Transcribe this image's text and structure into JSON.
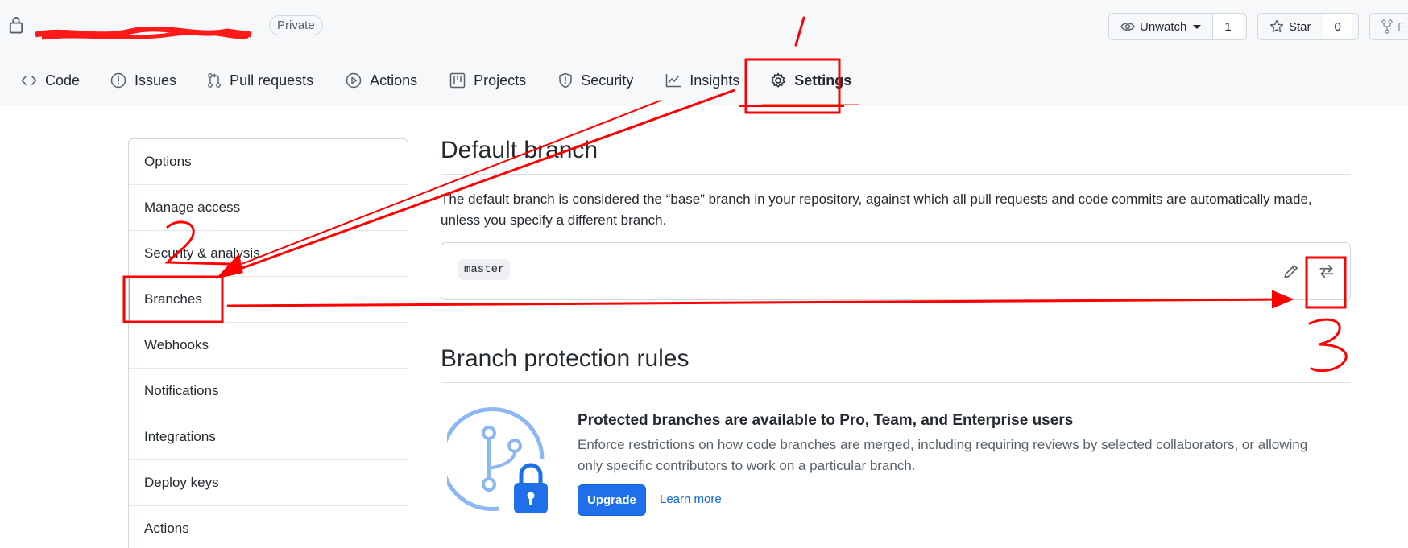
{
  "repo": {
    "visibility": "Private",
    "watch": {
      "label": "Unwatch",
      "count": "1"
    },
    "star": {
      "label": "Star",
      "count": "0"
    },
    "fork": {
      "label": "F"
    }
  },
  "nav": {
    "tabs": [
      {
        "label": "Code",
        "icon": "code-icon"
      },
      {
        "label": "Issues",
        "icon": "issue-icon"
      },
      {
        "label": "Pull requests",
        "icon": "pull-request-icon"
      },
      {
        "label": "Actions",
        "icon": "play-icon"
      },
      {
        "label": "Projects",
        "icon": "project-icon"
      },
      {
        "label": "Security",
        "icon": "shield-icon"
      },
      {
        "label": "Insights",
        "icon": "graph-icon"
      },
      {
        "label": "Settings",
        "icon": "gear-icon",
        "selected": true
      }
    ]
  },
  "sidebar": {
    "items": [
      {
        "label": "Options"
      },
      {
        "label": "Manage access"
      },
      {
        "label": "Security & analysis"
      },
      {
        "label": "Branches",
        "active": true
      },
      {
        "label": "Webhooks"
      },
      {
        "label": "Notifications"
      },
      {
        "label": "Integrations"
      },
      {
        "label": "Deploy keys"
      },
      {
        "label": "Actions"
      }
    ]
  },
  "default_branch": {
    "heading": "Default branch",
    "description": "The default branch is considered the “base” branch in your repository, against which all pull requests and code commits are automatically made, unless you specify a different branch.",
    "branch_name": "master",
    "edit_icon": "pencil-icon",
    "switch_icon": "arrow-switch-icon"
  },
  "protection": {
    "heading": "Branch protection rules",
    "upsell_title": "Protected branches are available to Pro, Team, and Enterprise users",
    "upsell_text": "Enforce restrictions on how code branches are merged, including requiring reviews by selected collaborators, or allowing only specific contributors to work on a particular branch.",
    "upgrade_label": "Upgrade",
    "learn_more_label": "Learn more"
  },
  "annotations": {
    "color": "#ff0000"
  },
  "colors": {
    "link": "#0969da",
    "upgrade_button": "#1f6feb",
    "selected_tab_underline": "#fd8c73"
  }
}
